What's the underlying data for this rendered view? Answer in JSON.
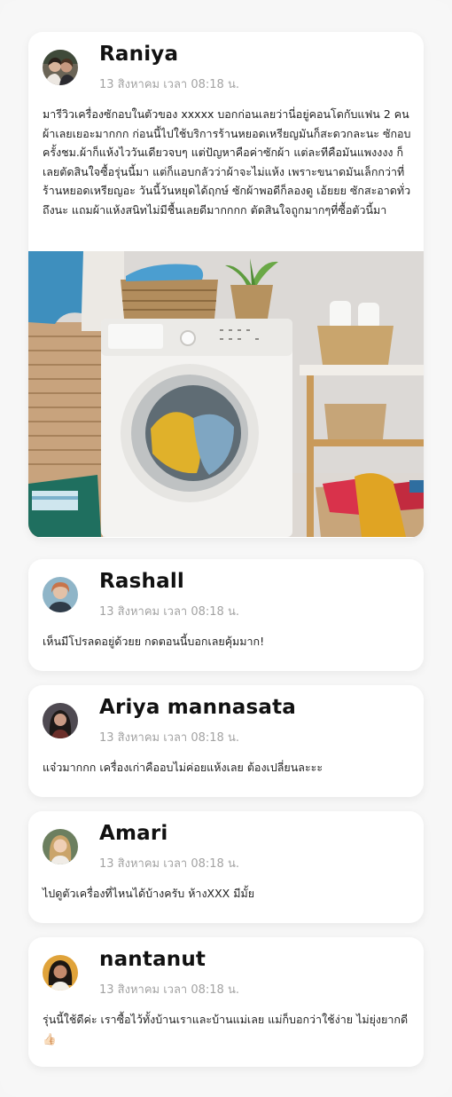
{
  "posts": [
    {
      "author": "Raniya",
      "time": "13 สิงหาคม เวลา 08:18 น.",
      "text": "มารีวิวเครื่องซักอบในตัวของ xxxxx บอกก่อนเลยว่านี่อยู่คอนโดกับแฟน 2 คน ผ้าเลยเยอะมากกก ก่อนนี้ไปใช้บริการร้านหยอดเหรียญมันก็สะดวกละนะ ซักอบครั้งชม.ผ้าก็แห้งไววันเดียวจบๆ แต่ปัญหาคือค่าซักผ้า แต่ละทีคือมันแพงงงง ก็เลยตัดสินใจซื้อรุ่นนี้มา แต่ก็แอบกลัวว่าผ้าจะไม่แห้ง เพราะขนาดมันเล็กกว่าที่ร้านหยอดเหรียญอะ วันนี้วันหยุดได้ฤกษ์ ซักผ้าพอดีก็ลองดู เอ้ยยย ซักสะอาดทั่วถึงนะ แถมผ้าแห้งสนิทไม่มีชื้นเลยดีมากกกก ตัดสินใจถูกมากๆที่ซื้อตัวนี้มา"
    },
    {
      "author": "Rashall",
      "time": "13 สิงหาคม เวลา 08:18 น.",
      "text": "เห็นมีโปรลดอยู่ด้วยย กดตอนนี้บอกเลยคุ้มมาก!"
    },
    {
      "author": "Ariya mannasata",
      "time": "13 สิงหาคม เวลา 08:18 น.",
      "text": "แจ๋วมากกก เครื่องเก่าคืออบไม่ค่อยแห้งเลย ต้องเปลี่ยนละะะ"
    },
    {
      "author": "Amari",
      "time": "13 สิงหาคม เวลา 08:18 น.",
      "text": "ไปดูตัวเครื่องที่ไหนได้บ้างครับ ห้างXXX มีมั้ย"
    },
    {
      "author": "nantanut",
      "time": "13 สิงหาคม เวลา 08:18 น.",
      "text": "รุ่นนี้ใช้ดีค่ะ เราซื้อไว้ทั้งบ้านเราและบ้านแม่เลย แม่ก็บอกว่าใช้ง่าย ไม่ยุ่งยากดี 👍🏻"
    }
  ]
}
